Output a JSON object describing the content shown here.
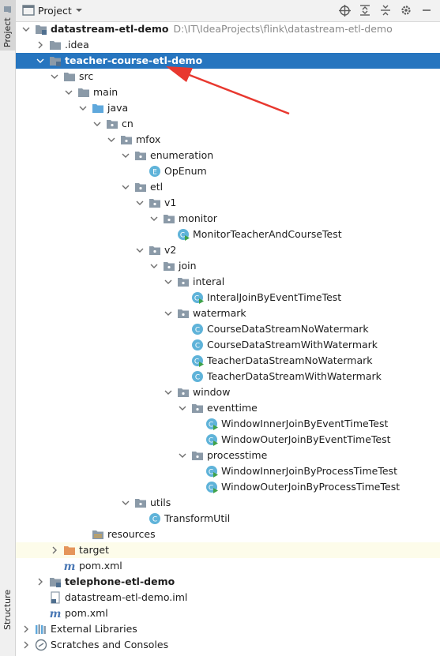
{
  "side": {
    "project_tab": "Project",
    "structure_tab": "Structure"
  },
  "toolbar": {
    "title": "Project"
  },
  "tree": [
    {
      "label": "datastream-etl-demo",
      "path": "D:\\IT\\IdeaProjects\\flink\\datastream-etl-demo",
      "depth": 0,
      "chev": "down",
      "icon": "module-folder-icon",
      "bold": true
    },
    {
      "label": ".idea",
      "depth": 1,
      "chev": "right",
      "icon": "folder-icon"
    },
    {
      "label": "teacher-course-etl-demo",
      "depth": 1,
      "chev": "down",
      "icon": "module-folder-icon",
      "bold": true,
      "selected": true
    },
    {
      "label": "src",
      "depth": 2,
      "chev": "down",
      "icon": "folder-icon"
    },
    {
      "label": "main",
      "depth": 3,
      "chev": "down",
      "icon": "folder-icon"
    },
    {
      "label": "java",
      "depth": 4,
      "chev": "down",
      "icon": "source-folder-icon"
    },
    {
      "label": "cn",
      "depth": 5,
      "chev": "down",
      "icon": "package-icon"
    },
    {
      "label": "mfox",
      "depth": 6,
      "chev": "down",
      "icon": "package-icon"
    },
    {
      "label": "enumeration",
      "depth": 7,
      "chev": "down",
      "icon": "package-icon"
    },
    {
      "label": "OpEnum",
      "depth": 8,
      "icon": "enum-icon"
    },
    {
      "label": "etl",
      "depth": 7,
      "chev": "down",
      "icon": "package-icon"
    },
    {
      "label": "v1",
      "depth": 8,
      "chev": "down",
      "icon": "package-icon"
    },
    {
      "label": "monitor",
      "depth": 9,
      "chev": "down",
      "icon": "package-icon"
    },
    {
      "label": "MonitorTeacherAndCourseTest",
      "depth": 10,
      "icon": "runnable-class-icon"
    },
    {
      "label": "v2",
      "depth": 8,
      "chev": "down",
      "icon": "package-icon"
    },
    {
      "label": "join",
      "depth": 9,
      "chev": "down",
      "icon": "package-icon"
    },
    {
      "label": "interal",
      "depth": 10,
      "chev": "down",
      "icon": "package-icon"
    },
    {
      "label": "InteralJoinByEventTimeTest",
      "depth": 11,
      "icon": "runnable-class-icon"
    },
    {
      "label": "watermark",
      "depth": 10,
      "chev": "down",
      "icon": "package-icon"
    },
    {
      "label": "CourseDataStreamNoWatermark",
      "depth": 11,
      "icon": "class-icon"
    },
    {
      "label": "CourseDataStreamWithWatermark",
      "depth": 11,
      "icon": "class-icon"
    },
    {
      "label": "TeacherDataStreamNoWatermark",
      "depth": 11,
      "icon": "runnable-class-icon"
    },
    {
      "label": "TeacherDataStreamWithWatermark",
      "depth": 11,
      "icon": "class-icon"
    },
    {
      "label": "window",
      "depth": 10,
      "chev": "down",
      "icon": "package-icon"
    },
    {
      "label": "eventtime",
      "depth": 11,
      "chev": "down",
      "icon": "package-icon"
    },
    {
      "label": "WindowInnerJoinByEventTimeTest",
      "depth": 12,
      "icon": "runnable-class-icon"
    },
    {
      "label": "WindowOuterJoinByEventTimeTest",
      "depth": 12,
      "icon": "runnable-class-icon"
    },
    {
      "label": "processtime",
      "depth": 11,
      "chev": "down",
      "icon": "package-icon"
    },
    {
      "label": "WindowInnerJoinByProcessTimeTest",
      "depth": 12,
      "icon": "runnable-class-icon"
    },
    {
      "label": "WindowOuterJoinByProcessTimeTest",
      "depth": 12,
      "icon": "runnable-class-icon"
    },
    {
      "label": "utils",
      "depth": 7,
      "chev": "down",
      "icon": "package-icon"
    },
    {
      "label": "TransformUtil",
      "depth": 8,
      "icon": "class-icon"
    },
    {
      "label": "resources",
      "depth": 4,
      "icon": "resources-folder-icon"
    },
    {
      "label": "target",
      "depth": 2,
      "chev": "right",
      "icon": "excluded-folder-icon",
      "highlight": true
    },
    {
      "label": "pom.xml",
      "depth": 2,
      "icon": "maven-icon"
    },
    {
      "label": "telephone-etl-demo",
      "depth": 1,
      "chev": "right",
      "icon": "module-folder-icon",
      "bold": true
    },
    {
      "label": "datastream-etl-demo.iml",
      "depth": 1,
      "icon": "iml-file-icon"
    },
    {
      "label": "pom.xml",
      "depth": 1,
      "icon": "maven-icon"
    },
    {
      "label": "External Libraries",
      "depth": 0,
      "chev": "right",
      "icon": "libraries-icon"
    },
    {
      "label": "Scratches and Consoles",
      "depth": 0,
      "chev": "right",
      "icon": "scratches-icon"
    }
  ],
  "colors": {
    "selection": "#2675bf",
    "folder": "#8b9aa8",
    "source_folder": "#5fa8dc",
    "class": "#5fb3d9",
    "annotation_arrow": "#e8382f"
  }
}
